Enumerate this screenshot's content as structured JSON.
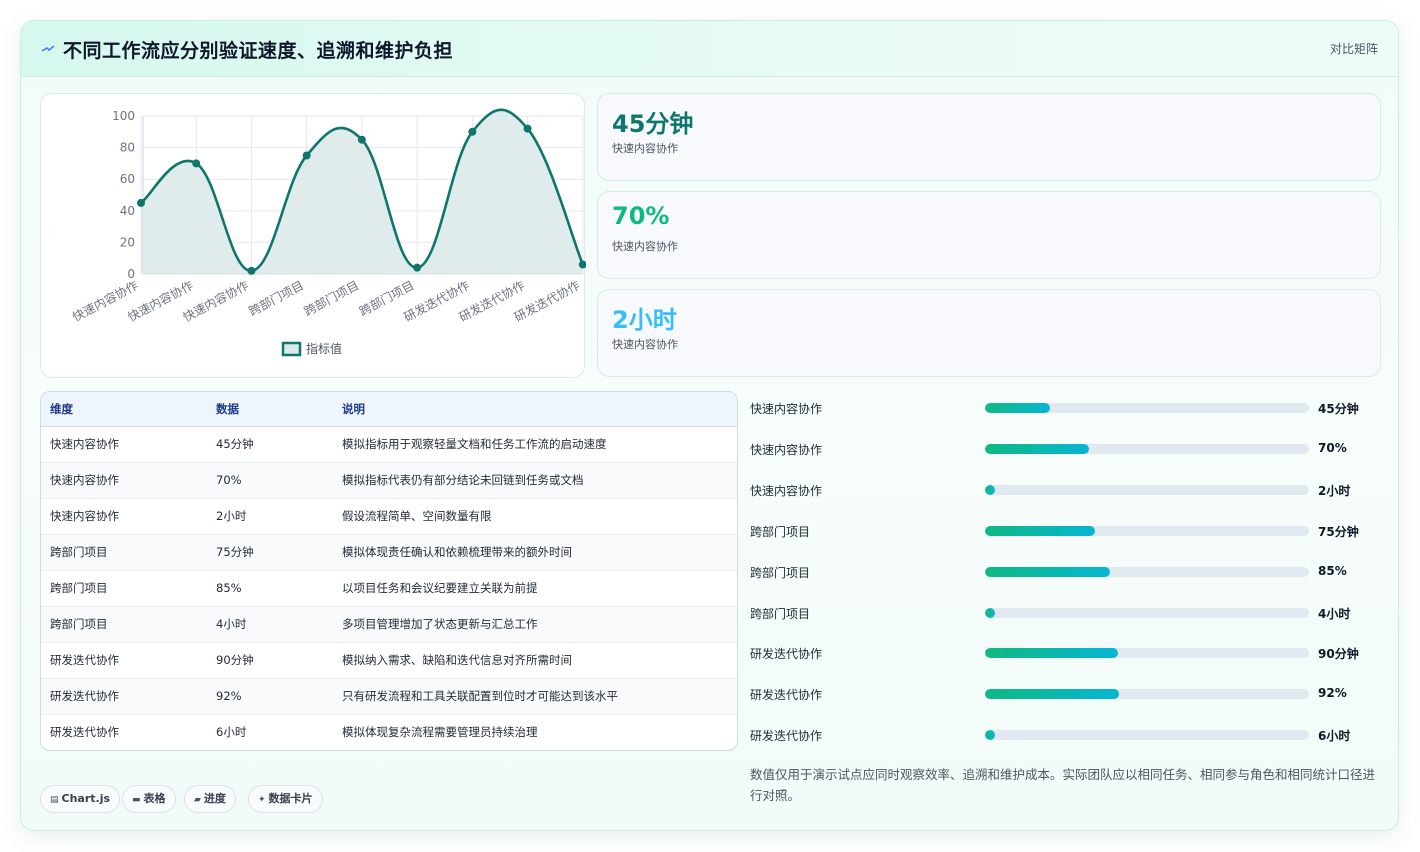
{
  "header": {
    "title": "不同工作流应分别验证速度、追溯和维护负担",
    "tag": "对比矩阵",
    "icon": "lightning-icon"
  },
  "chart_data": {
    "type": "line",
    "categories": [
      "快速内容协作",
      "快速内容协作",
      "快速内容协作",
      "跨部门项目",
      "跨部门项目",
      "跨部门项目",
      "研发迭代协作",
      "研发迭代协作",
      "研发迭代协作"
    ],
    "series": [
      {
        "name": "指标值",
        "values": [
          45,
          70,
          2,
          75,
          85,
          4,
          90,
          92,
          6
        ]
      }
    ],
    "ylim": [
      0,
      100
    ],
    "yticks": [
      0,
      20,
      40,
      60,
      80,
      100
    ],
    "grid": true,
    "legend_position": "bottom",
    "line_color": "#0f766e",
    "fill_color": "#dbe9e8"
  },
  "stats": [
    {
      "value": "45分钟",
      "label": "快速内容协作",
      "color": "#0f766e"
    },
    {
      "value": "70%",
      "label": "快速内容协作",
      "color": "#10b981"
    },
    {
      "value": "2小时",
      "label": "快速内容协作",
      "color": "#38bdf8"
    }
  ],
  "table": {
    "headers": [
      "维度",
      "数据",
      "说明"
    ],
    "rows": [
      [
        "快速内容协作",
        "45分钟",
        "模拟指标用于观察轻量文档和任务工作流的启动速度"
      ],
      [
        "快速内容协作",
        "70%",
        "模拟指标代表仍有部分结论未回链到任务或文档"
      ],
      [
        "快速内容协作",
        "2小时",
        "假设流程简单、空间数量有限"
      ],
      [
        "跨部门项目",
        "75分钟",
        "模拟体现责任确认和依赖梳理带来的额外时间"
      ],
      [
        "跨部门项目",
        "85%",
        "以项目任务和会议纪要建立关联为前提"
      ],
      [
        "跨部门项目",
        "4小时",
        "多项目管理增加了状态更新与汇总工作"
      ],
      [
        "研发迭代协作",
        "90分钟",
        "模拟纳入需求、缺陷和迭代信息对齐所需时间"
      ],
      [
        "研发迭代协作",
        "92%",
        "只有研发流程和工具关联配置到位时才可能达到该水平"
      ],
      [
        "研发迭代协作",
        "6小时",
        "模拟体现复杂流程需要管理员持续治理"
      ]
    ]
  },
  "progress": [
    {
      "label": "快速内容协作",
      "value": "45分钟",
      "fill": 0.2
    },
    {
      "label": "快速内容协作",
      "value": "70%",
      "fill": 0.32
    },
    {
      "label": "快速内容协作",
      "value": "2小时",
      "fill": 0.03
    },
    {
      "label": "跨部门项目",
      "value": "75分钟",
      "fill": 0.34
    },
    {
      "label": "跨部门项目",
      "value": "85%",
      "fill": 0.385
    },
    {
      "label": "跨部门项目",
      "value": "4小时",
      "fill": 0.03
    },
    {
      "label": "研发迭代协作",
      "value": "90分钟",
      "fill": 0.41
    },
    {
      "label": "研发迭代协作",
      "value": "92%",
      "fill": 0.415
    },
    {
      "label": "研发迭代协作",
      "value": "6小时",
      "fill": 0.03
    }
  ],
  "footnote": "数值仅用于演示试点应同时观察效率、追溯和维护成本。实际团队应以相同任务、相同参与角色和相同统计口径进行对照。",
  "badges": [
    {
      "label": "Chart.js",
      "icon": "chart-icon"
    },
    {
      "label": "表格",
      "icon": "table-icon"
    },
    {
      "label": "进度",
      "icon": "progress-icon"
    },
    {
      "label": "数据卡片",
      "icon": "sparkle-icon"
    }
  ]
}
